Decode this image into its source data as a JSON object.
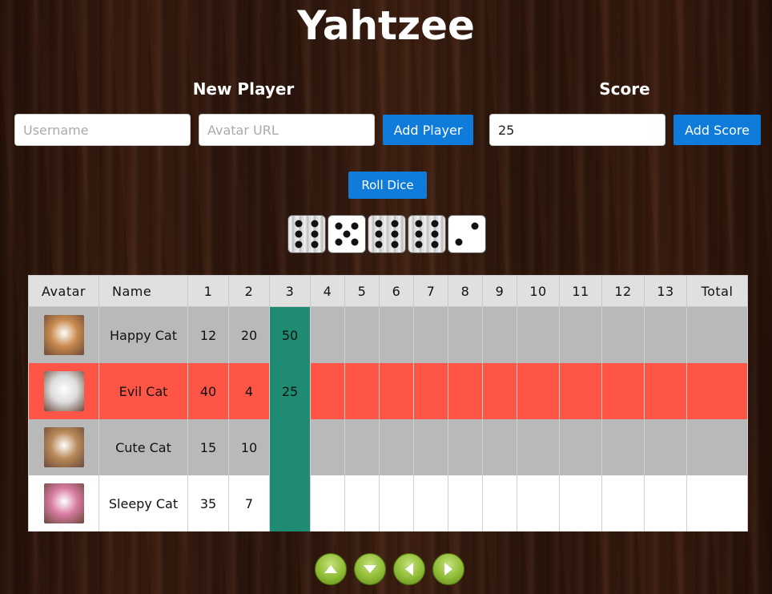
{
  "app": {
    "title": "Yahtzee"
  },
  "new_player": {
    "heading": "New Player",
    "username_placeholder": "Username",
    "avatar_placeholder": "Avatar URL",
    "add_button": "Add Player"
  },
  "score": {
    "heading": "Score",
    "value": "25",
    "add_button": "Add Score"
  },
  "dice": {
    "roll_button": "Roll Dice",
    "values": [
      6,
      5,
      6,
      6,
      2
    ],
    "held": [
      true,
      false,
      true,
      true,
      false
    ]
  },
  "table": {
    "headers": [
      "Avatar",
      "Name",
      "1",
      "2",
      "3",
      "4",
      "5",
      "6",
      "7",
      "8",
      "9",
      "10",
      "11",
      "12",
      "13",
      "Total"
    ],
    "active_column": "3",
    "rows": [
      {
        "name": "Happy Cat",
        "style": "gray",
        "scores": [
          "12",
          "20",
          "50",
          "",
          "",
          "",
          "",
          "",
          "",
          "",
          "",
          "",
          ""
        ],
        "total": "",
        "avatar_color": "#c98a4e"
      },
      {
        "name": "Evil Cat",
        "style": "red",
        "scores": [
          "40",
          "4",
          "25",
          "",
          "",
          "",
          "",
          "",
          "",
          "",
          "",
          "",
          ""
        ],
        "total": "",
        "avatar_color": "#dcdcdc"
      },
      {
        "name": "Cute Cat",
        "style": "gray",
        "scores": [
          "15",
          "10",
          "",
          "",
          "",
          "",
          "",
          "",
          "",
          "",
          "",
          "",
          ""
        ],
        "total": "",
        "avatar_color": "#b98a5a"
      },
      {
        "name": "Sleepy Cat",
        "style": "white",
        "scores": [
          "35",
          "7",
          "",
          "",
          "",
          "",
          "",
          "",
          "",
          "",
          "",
          "",
          ""
        ],
        "total": "",
        "avatar_color": "#d77aa0"
      }
    ]
  },
  "nav": {
    "buttons": [
      "arrow-up-icon",
      "arrow-down-icon",
      "arrow-left-icon",
      "arrow-right-icon"
    ]
  },
  "colors": {
    "button_blue": "#0f7bdb",
    "active_column": "#1f8b72",
    "current_player_row": "#ff5547",
    "nav_green": "#8fbb35"
  }
}
